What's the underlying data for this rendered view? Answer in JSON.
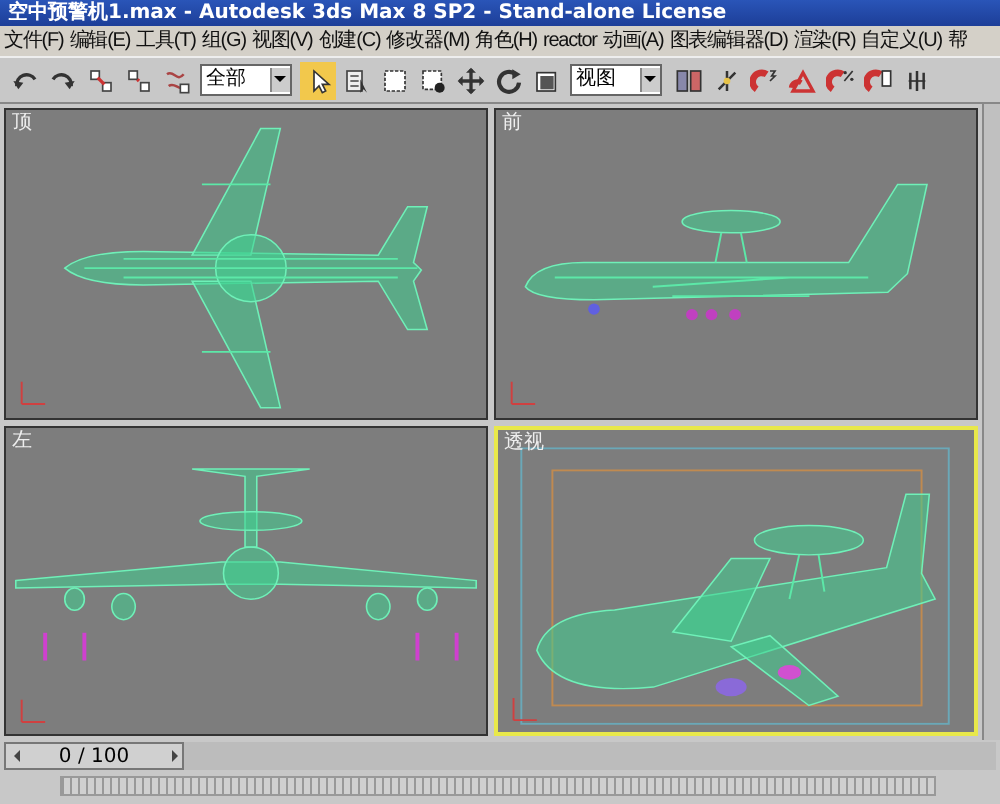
{
  "window": {
    "title": "空中预警机1.max - Autodesk 3ds Max 8 SP2 - Stand-alone License"
  },
  "menu": [
    "文件(F)",
    "编辑(E)",
    "工具(T)",
    "组(G)",
    "视图(V)",
    "创建(C)",
    "修改器(M)",
    "角色(H)",
    "reactor",
    "动画(A)",
    "图表编辑器(D)",
    "渲染(R)",
    "自定义(U)",
    "帮"
  ],
  "toolbar": [
    {
      "kind": "icon",
      "selected": false
    },
    {
      "kind": "icon",
      "selected": false
    },
    {
      "kind": "icon",
      "selected": false
    },
    {
      "kind": "icon",
      "selected": false
    },
    {
      "kind": "icon",
      "selected": false
    },
    {
      "kind": "dropdown",
      "value": "全部"
    },
    {
      "kind": "icon",
      "selected": true
    },
    {
      "kind": "icon",
      "selected": false
    },
    {
      "kind": "icon",
      "selected": false
    },
    {
      "kind": "icon",
      "selected": false
    },
    {
      "kind": "icon",
      "selected": false
    },
    {
      "kind": "icon",
      "selected": false
    },
    {
      "kind": "icon",
      "selected": false
    },
    {
      "kind": "dropdown",
      "value": "视图"
    },
    {
      "kind": "icon",
      "selected": false
    },
    {
      "kind": "icon",
      "selected": false
    },
    {
      "kind": "icon",
      "selected": false
    },
    {
      "kind": "icon",
      "selected": false
    },
    {
      "kind": "icon",
      "selected": false
    },
    {
      "kind": "icon",
      "selected": false
    },
    {
      "kind": "icon",
      "selected": false
    }
  ],
  "viewports": [
    {
      "label": "顶",
      "kind": "top",
      "active": false
    },
    {
      "label": "前",
      "kind": "front",
      "active": false
    },
    {
      "label": "左",
      "kind": "left",
      "active": false
    },
    {
      "label": "透视",
      "kind": "perspective",
      "active": true
    }
  ],
  "timeline": {
    "frame": "0 / 100",
    "level": 0
  }
}
